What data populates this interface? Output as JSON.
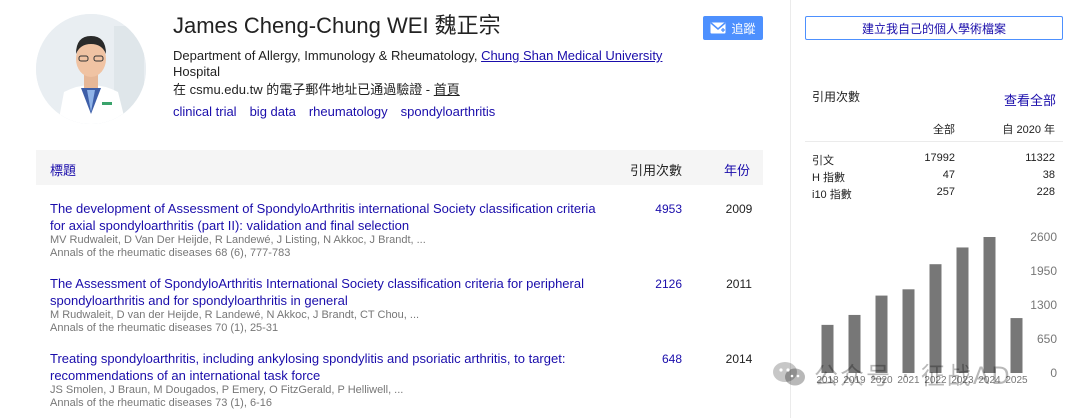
{
  "profile": {
    "name": "James Cheng-Chung WEI 魏正宗",
    "affiliation_prefix": "Department of Allergy, Immunology & Rheumatology, ",
    "affiliation_university": "Chung Shan Medical University",
    "affiliation_suffix": "Hospital",
    "verified_text": "在 csmu.edu.tw 的電子郵件地址已通過驗證 - ",
    "homepage_label": "首頁",
    "interests": [
      "clinical trial",
      "big data",
      "rheumatology",
      "spondyloarthritis"
    ]
  },
  "follow_button": {
    "label": "追蹤",
    "icon": "mail-icon"
  },
  "table": {
    "header": {
      "title": "標題",
      "cited_by": "引用次數",
      "year": "年份"
    },
    "rows": [
      {
        "title": "The development of Assessment of SpondyloArthritis international Society classification criteria for axial spondyloarthritis (part II): validation and final selection",
        "authors": "MV Rudwaleit, D Van Der Heijde, R Landewé, J Listing, N Akkoc, J Brandt, ...",
        "venue": "Annals of the rheumatic diseases 68 (6), 777-783",
        "cited": "4953",
        "year": "2009"
      },
      {
        "title": "The Assessment of SpondyloArthritis International Society classification criteria for peripheral spondyloarthritis and for spondyloarthritis in general",
        "authors": "M Rudwaleit, D van der Heijde, R Landewé, N Akkoc, J Brandt, CT Chou, ...",
        "venue": "Annals of the rheumatic diseases 70 (1), 25-31",
        "cited": "2126",
        "year": "2011"
      },
      {
        "title": "Treating spondyloarthritis, including ankylosing spondylitis and psoriatic arthritis, to target: recommendations of an international task force",
        "authors": "JS Smolen, J Braun, M Dougados, P Emery, O FitzGerald, P Helliwell, ...",
        "venue": "Annals of the rheumatic diseases 73 (1), 6-16",
        "cited": "648",
        "year": "2014"
      }
    ]
  },
  "sidebar": {
    "create_profile_label": "建立我自己的個人學術檔案",
    "cited_by_label": "引用次數",
    "view_all_label": "查看全部",
    "stats_header": {
      "all": "全部",
      "since": "自 2020 年"
    },
    "stats": [
      {
        "label": "引文",
        "all": "17992",
        "since": "11322"
      },
      {
        "label": "H 指數",
        "all": "47",
        "since": "38"
      },
      {
        "label": "i10 指數",
        "all": "257",
        "since": "228"
      }
    ]
  },
  "chart_data": {
    "type": "bar",
    "categories": [
      "2018",
      "2019",
      "2020",
      "2021",
      "2022",
      "2023",
      "2024",
      "2025"
    ],
    "values": [
      920,
      1110,
      1480,
      1600,
      2080,
      2400,
      2600,
      1050
    ],
    "ylim": [
      0,
      2600
    ],
    "yticks": [
      "2600",
      "1950",
      "1300",
      "650",
      "0"
    ],
    "ytick_values": [
      2600,
      1950,
      1300,
      650,
      0
    ],
    "bar_color": "#777777",
    "grid": false
  },
  "watermark": {
    "text": "公众号 · 征战AD"
  },
  "colors": {
    "link": "#1a0dab",
    "accent": "#4d90fe",
    "header_bg": "#f5f5f5"
  }
}
